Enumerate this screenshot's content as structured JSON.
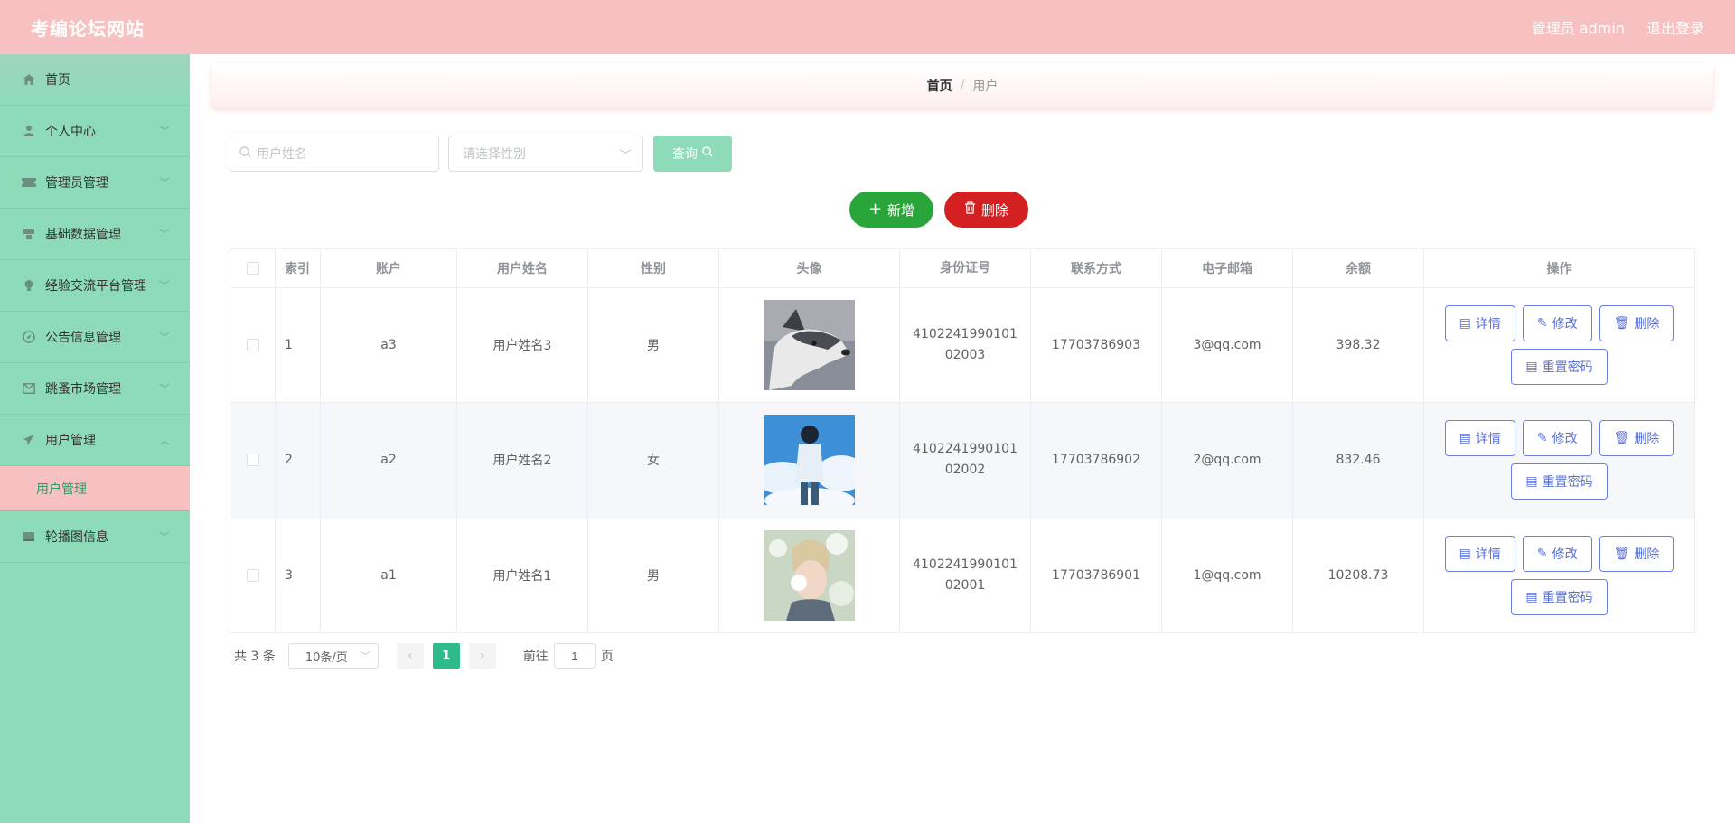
{
  "header": {
    "title": "考编论坛网站",
    "role_label": "管理员 admin",
    "logout_label": "退出登录"
  },
  "sidebar": {
    "items": [
      {
        "label": "首页",
        "icon": "home-icon"
      },
      {
        "label": "个人中心",
        "icon": "user-icon"
      },
      {
        "label": "管理员管理",
        "icon": "ticket-icon"
      },
      {
        "label": "基础数据管理",
        "icon": "box-icon"
      },
      {
        "label": "经验交流平台管理",
        "icon": "bulb-icon"
      },
      {
        "label": "公告信息管理",
        "icon": "compass-icon"
      },
      {
        "label": "跳蚤市场管理",
        "icon": "mail-icon"
      },
      {
        "label": "用户管理",
        "icon": "send-icon"
      },
      {
        "label": "轮播图信息",
        "icon": "book-icon"
      }
    ],
    "active_sub": "用户管理"
  },
  "breadcrumb": {
    "home": "首页",
    "current": "用户"
  },
  "search": {
    "name_placeholder": "用户姓名",
    "gender_placeholder": "请选择性别",
    "query_label": "查询"
  },
  "actions": {
    "add_label": "新增",
    "delete_label": "删除"
  },
  "table": {
    "headers": [
      "索引",
      "账户",
      "用户姓名",
      "性别",
      "头像",
      "身份证号",
      "联系方式",
      "电子邮箱",
      "余额",
      "操作"
    ],
    "rows": [
      {
        "index": "1",
        "account": "a3",
        "name": "用户姓名3",
        "gender": "男",
        "id_card": "410224199010102003",
        "phone": "17703786903",
        "email": "3@qq.com",
        "balance": "398.32"
      },
      {
        "index": "2",
        "account": "a2",
        "name": "用户姓名2",
        "gender": "女",
        "id_card": "410224199010102002",
        "phone": "17703786902",
        "email": "2@qq.com",
        "balance": "832.46"
      },
      {
        "index": "3",
        "account": "a1",
        "name": "用户姓名1",
        "gender": "男",
        "id_card": "410224199010102001",
        "phone": "17703786901",
        "email": "1@qq.com",
        "balance": "10208.73"
      }
    ],
    "op_labels": {
      "detail": "详情",
      "edit": "修改",
      "delete": "删除",
      "reset": "重置密码"
    }
  },
  "pagination": {
    "total": "共 3 条",
    "page_size": "10条/页",
    "current_page": "1",
    "goto_label": "前往",
    "goto_value": "1",
    "page_suffix": "页"
  },
  "colors": {
    "header": "#f8c1c1",
    "sidebar": "#8ddbb9",
    "add_button": "#2aa53a",
    "delete_button": "#d42020",
    "op_button": "#5a6fd8",
    "active_page": "#2dbb8b"
  }
}
